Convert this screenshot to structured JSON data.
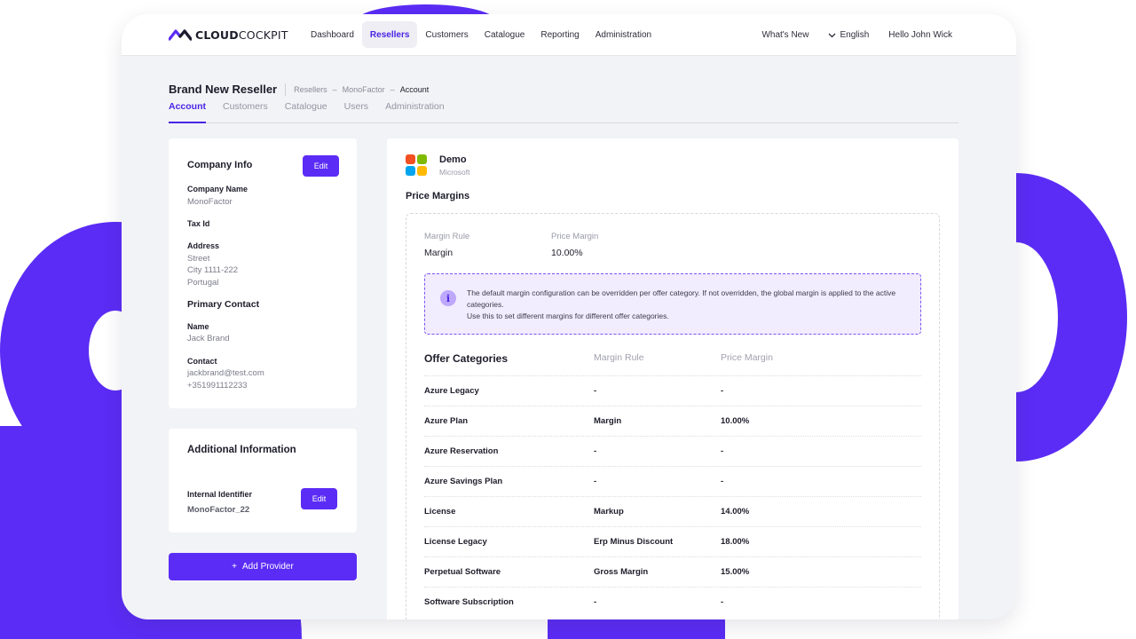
{
  "brand": {
    "logo_text_bold": "CLOUD",
    "logo_text_rest": "COCKPIT"
  },
  "nav": {
    "items": [
      {
        "label": "Dashboard"
      },
      {
        "label": "Resellers"
      },
      {
        "label": "Customers"
      },
      {
        "label": "Catalogue"
      },
      {
        "label": "Reporting"
      },
      {
        "label": "Administration"
      }
    ],
    "whats_new": "What's New",
    "language": "English",
    "greeting": "Hello John Wick"
  },
  "page": {
    "title": "Brand New Reseller",
    "breadcrumb": [
      "Resellers",
      "MonoFactor",
      "Account"
    ],
    "tabs": [
      "Account",
      "Customers",
      "Catalogue",
      "Users",
      "Administration"
    ]
  },
  "company_info": {
    "title": "Company Info",
    "edit_label": "Edit",
    "company_name_label": "Company Name",
    "company_name": "MonoFactor",
    "tax_id_label": "Tax Id",
    "address_label": "Address",
    "address_street": "Street",
    "address_city": "City 1111-222",
    "address_country": "Portugal",
    "primary_contact_title": "Primary Contact",
    "name_label": "Name",
    "name": "Jack Brand",
    "contact_label": "Contact",
    "contact_email": "jackbrand@test.com",
    "contact_phone": "+351991112233"
  },
  "additional_info": {
    "title": "Additional Information",
    "internal_identifier_label": "Internal Identifier",
    "internal_identifier": "MonoFactor_22",
    "edit_label": "Edit"
  },
  "add_provider_label": "Add Provider",
  "provider": {
    "name": "Demo",
    "vendor": "Microsoft",
    "logo_colors": [
      "#f25022",
      "#7fba00",
      "#00a4ef",
      "#ffb900"
    ]
  },
  "price_margins": {
    "title": "Price Margins",
    "margin_rule_label": "Margin Rule",
    "margin_rule_value": "Margin",
    "price_margin_label": "Price Margin",
    "price_margin_value": "10.00%",
    "info_line1": "The default margin configuration can be overridden per offer category. If not overridden, the global margin is applied to the active categories.",
    "info_line2": "Use this to set different margins for different offer categories."
  },
  "offer_categories": {
    "headers": {
      "category": "Offer Categories",
      "rule": "Margin Rule",
      "margin": "Price Margin"
    },
    "rows": [
      {
        "category": "Azure Legacy",
        "rule": "-",
        "margin": "-"
      },
      {
        "category": "Azure Plan",
        "rule": "Margin",
        "margin": "10.00%"
      },
      {
        "category": "Azure Reservation",
        "rule": "-",
        "margin": "-"
      },
      {
        "category": "Azure Savings Plan",
        "rule": "-",
        "margin": "-"
      },
      {
        "category": "License",
        "rule": "Markup",
        "margin": "14.00%"
      },
      {
        "category": "License Legacy",
        "rule": "Erp Minus Discount",
        "margin": "18.00%"
      },
      {
        "category": "Perpetual Software",
        "rule": "Gross Margin",
        "margin": "15.00%"
      },
      {
        "category": "Software Subscription",
        "rule": "-",
        "margin": "-"
      }
    ]
  },
  "colors": {
    "accent": "#5b2cf5",
    "info_bg": "#f1ecfe"
  }
}
